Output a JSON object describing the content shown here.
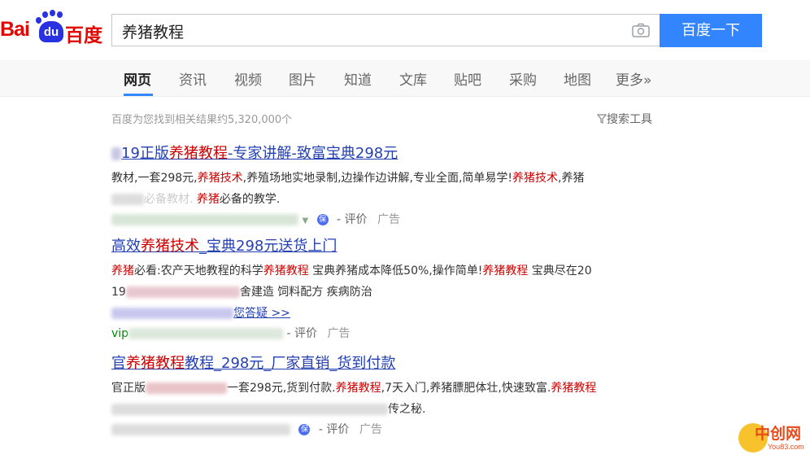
{
  "header": {
    "logo_bai": "Bai",
    "logo_du": "du",
    "logo_cn": "百度",
    "query": "养猪教程",
    "search_button": "百度一下"
  },
  "tabs": [
    {
      "label": "网页",
      "active": true
    },
    {
      "label": "资讯"
    },
    {
      "label": "视频"
    },
    {
      "label": "图片"
    },
    {
      "label": "知道"
    },
    {
      "label": "文库"
    },
    {
      "label": "贴吧"
    },
    {
      "label": "采购"
    },
    {
      "label": "地图"
    },
    {
      "label": "更多»"
    }
  ],
  "stats": "百度为您找到相关结果约5,320,000个",
  "tools_label": "搜索工具",
  "results": [
    {
      "title_a": "19正版",
      "title_em": "养猪教程",
      "title_b": "-专家讲解-致富宝典298元",
      "desc1_a": "教材,一套298元,",
      "desc1_em1": "养猪技术",
      "desc1_b": ",养殖场地实地录制,边操作边讲解,专业全面,简单易学!",
      "desc1_em2": "养猪技术",
      "desc1_c": ",养猪",
      "desc2_a": "必备教材.",
      "desc2_em": "养猪",
      "desc2_b": "必备的教学.",
      "review": "评价",
      "ad": "广告"
    },
    {
      "title_a": "高效",
      "title_em": "养猪技术",
      "title_b": "_宝典298元送货上门",
      "desc1_em1": "养猪",
      "desc1_a": "必看:农产天地教程的科学",
      "desc1_em2": "养猪教程",
      "desc1_b": " 宝典养猪成本降低50%,操作简单!",
      "desc1_em3": "养猪教程",
      "desc1_c": " 宝典尽在20",
      "desc2_a": "19",
      "desc2_b": "舍建造 饲料配方 疾病防治",
      "link": "您答疑 >>",
      "site_prefix": "vip",
      "review": "评价",
      "ad": "广告"
    },
    {
      "title_a": "官",
      "title_em": "养猪教程",
      "title_b": "教程_298元_厂家直销_货到付款",
      "desc1_a": "官正版",
      "desc1_b": "一套298元,货到付款.",
      "desc1_em1": "养猪教程",
      "desc1_c": ",7天入门,养猪膘肥体壮,快速致富.",
      "desc1_em2": "养猪教程",
      "desc2_a": "传之秘.",
      "review": "评价",
      "ad": "广告"
    }
  ],
  "watermark": {
    "text": "中创网",
    "sub": "You83.com"
  },
  "colors": {
    "link": "#2440b3",
    "highlight": "#c00",
    "button": "#3385ff",
    "brand_red": "#e10602",
    "brand_blue": "#2932e1"
  }
}
